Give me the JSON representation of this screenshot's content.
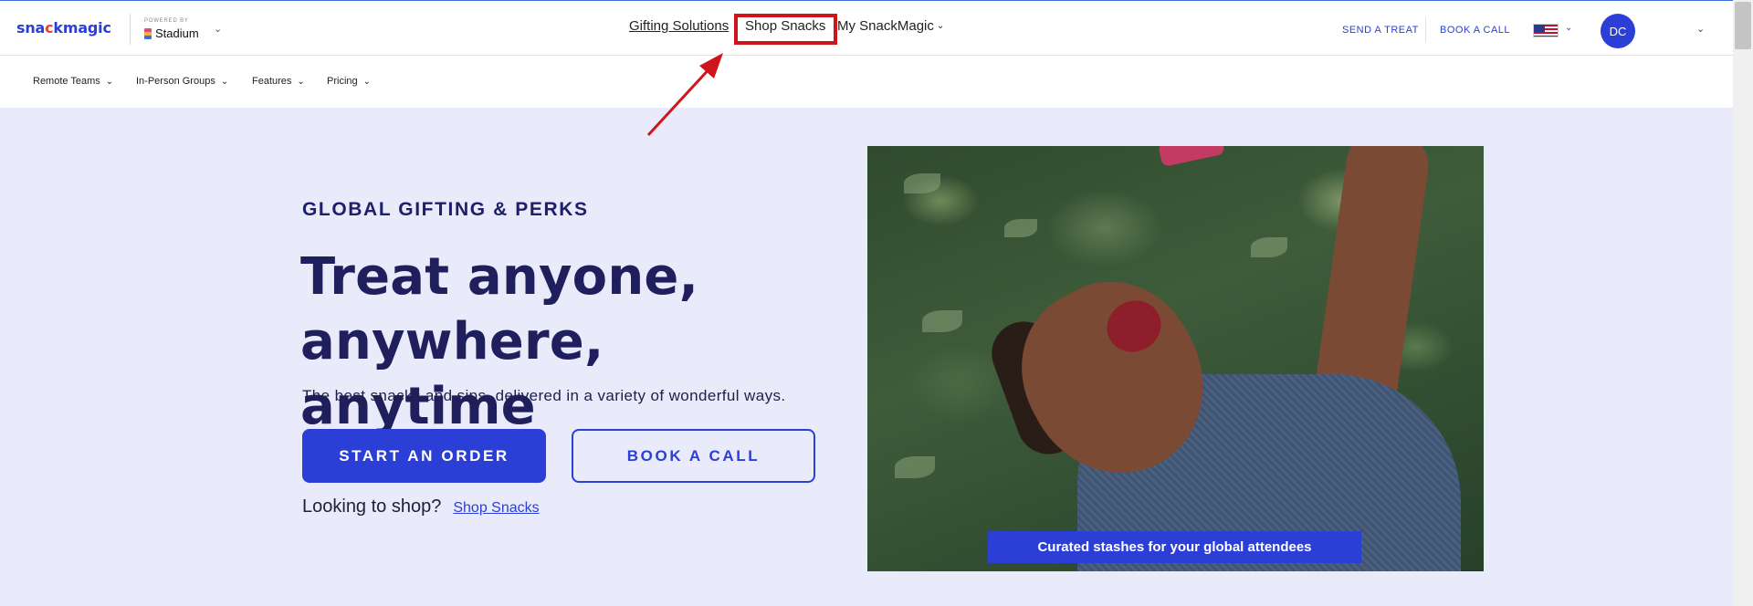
{
  "header": {
    "logo": {
      "pre": "sna",
      "dot": "c",
      "post": "kmagic"
    },
    "powered_by": "POWERED BY",
    "stadium": "Stadium",
    "nav": {
      "gifting": "Gifting Solutions",
      "shop": "Shop Snacks",
      "my": "My SnackMagic"
    },
    "send_treat": "SEND A TREAT",
    "book_call": "BOOK A CALL",
    "avatar_initials": "DC"
  },
  "subnav": {
    "items": [
      "Remote Teams",
      "In-Person Groups",
      "Features",
      "Pricing"
    ]
  },
  "hero": {
    "eyebrow": "GLOBAL GIFTING & PERKS",
    "headline": "Treat anyone, anywhere, anytime",
    "subtitle": "The best snacks and sips, delivered in a variety of wonderful ways.",
    "start_order": "START AN ORDER",
    "book_call": "BOOK A CALL",
    "looking": "Looking to shop?",
    "shop_link": "Shop Snacks",
    "caption": "Curated stashes for your global attendees"
  },
  "colors": {
    "brand_blue": "#2b3fd6",
    "hero_bg": "#e9ebfa",
    "annotation_red": "#d0141c"
  },
  "icons": [
    "chevron-down-icon",
    "us-flag-icon",
    "arrow-annotation-icon"
  ]
}
